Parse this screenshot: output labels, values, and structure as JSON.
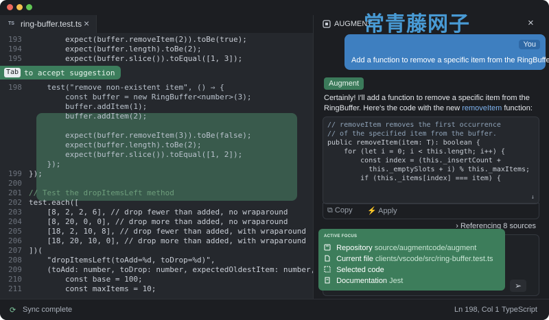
{
  "editor": {
    "tab": {
      "badge": "TS",
      "label": "ring-buffer.test.ts",
      "close": "×"
    },
    "hint": {
      "key": "Tab",
      "text": "to accept suggestion"
    },
    "lines": [
      {
        "num": "193",
        "code": "        expect(buffer.removeItem(2)).toBe(true);"
      },
      {
        "num": "194",
        "code": "        expect(buffer.length).toBe(2);"
      },
      {
        "num": "195",
        "code": "        expect(buffer.slice()).toEqual([1, 3]);"
      },
      {
        "num": "198",
        "code": "    test(\"remove non-existent item\", () ⇒ {"
      },
      {
        "num": "",
        "code": "        const buffer = new RingBuffer<number>(3);"
      },
      {
        "num": "",
        "code": "        buffer.addItem(1);"
      },
      {
        "num": "",
        "code": "        buffer.addItem(2);"
      },
      {
        "num": "",
        "code": ""
      },
      {
        "num": "",
        "code": "        expect(buffer.removeItem(3)).toBe(false);"
      },
      {
        "num": "",
        "code": "        expect(buffer.length).toBe(2);"
      },
      {
        "num": "",
        "code": "        expect(buffer.slice()).toEqual([1, 2]);"
      },
      {
        "num": "",
        "code": "    });"
      },
      {
        "num": "199",
        "code": "});"
      },
      {
        "num": "200",
        "code": ""
      },
      {
        "num": "201",
        "code": "// Test the dropItemsLeft method"
      },
      {
        "num": "202",
        "code": "test.each(["
      },
      {
        "num": "203",
        "code": "    [8, 2, 2, 6], // drop fewer than added, no wraparound"
      },
      {
        "num": "204",
        "code": "    [8, 20, 0, 0], // drop more than added, no wraparound"
      },
      {
        "num": "205",
        "code": "    [18, 2, 10, 8], // drop fewer than added, with wraparound"
      },
      {
        "num": "206",
        "code": "    [18, 20, 10, 0], // drop more than added, with wraparound"
      },
      {
        "num": "207",
        "code": "])("
      },
      {
        "num": "208",
        "code": "    \"dropItemsLeft(toAdd=%d, toDrop=%d)\","
      },
      {
        "num": "209",
        "code": "    (toAdd: number, toDrop: number, expectedOldestItem: number,"
      },
      {
        "num": "210",
        "code": "        const base = 100;"
      },
      {
        "num": "211",
        "code": "        const maxItems = 10;"
      }
    ]
  },
  "panel": {
    "title": "AUGMENT",
    "close": "×",
    "watermark": "常青藤网子",
    "you_badge": "You",
    "user_message": "Add a function to remove a specific item from the RingBuffer",
    "augment_badge": "Augment",
    "reply_prefix": "Certainly! I'll add a function to remove a specific item from the RingBuffer. Here's the code with the new ",
    "reply_fn": "removeItem",
    "reply_suffix": " function:",
    "code_lines": [
      "// removeItem removes the first occurrence",
      "// of the specified item from the buffer.",
      "public removeItem(item: T): boolean {",
      "    for (let i = 0; i < this.length; i++) {",
      "        const index = (this._insertCount +",
      "          this._emptySlots + i) % this._maxItems;",
      "        if (this._items[index] === item) {"
    ],
    "copy_label": "Copy",
    "apply_label": "Apply",
    "references": "Referencing 8 sources",
    "focus": {
      "title": "ACTIVE FOCUS",
      "repo_label": "Repository",
      "repo_value": "source/augmentcode/augment",
      "file_label": "Current file",
      "file_value": "clients/vscode/src/ring-buffer.test.ts",
      "selected_label": "Selected code",
      "docs_label": "Documentation",
      "docs_value": "Jest"
    }
  },
  "status": {
    "sync": "Sync complete",
    "position": "Ln 198, Col 1",
    "language": "TypeScript"
  },
  "colors": {
    "accent_green": "#3d7d5b",
    "user_blue": "#3e7fc0",
    "editor_bg": "#25282d"
  }
}
